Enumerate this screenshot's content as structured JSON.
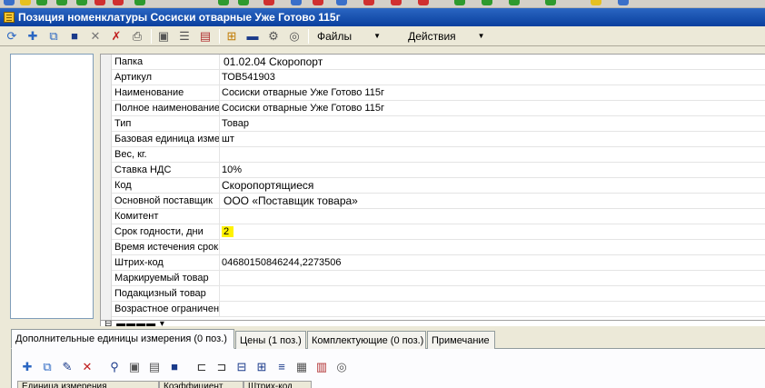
{
  "window": {
    "title": "Позиция номенклатуры Сосиски отварные Уже Готово 115г"
  },
  "toolbar": {
    "icons": [
      "refresh-icon",
      "add-icon",
      "copy-icon",
      "save-icon",
      "close-icon",
      "delete-mark-icon",
      "print-icon",
      "form-icon",
      "list-icon",
      "history-icon",
      "structure-icon",
      "monitor-icon",
      "settings-icon",
      "options-icon"
    ],
    "files_label": "Файлы",
    "actions_label": "Действия"
  },
  "properties": [
    {
      "label": "Папка",
      "value": "01.02.04 Скоропорт"
    },
    {
      "label": "Артикул",
      "value": "ТОВ541903"
    },
    {
      "label": "Наименование",
      "value": "Сосиски отварные Уже Готово 115г"
    },
    {
      "label": "Полное наименование",
      "value": "Сосиски отварные Уже Готово 115г"
    },
    {
      "label": "Тип",
      "value": "Товар"
    },
    {
      "label": "Базовая единица измерения",
      "value": "шт"
    },
    {
      "label": "Вес, кг.",
      "value": ""
    },
    {
      "label": "Ставка НДС",
      "value": "10%"
    },
    {
      "label": "Код",
      "value": "Скоропортящиеся"
    },
    {
      "label": "Основной поставщик",
      "value": "ООО «Поставщик товара»"
    },
    {
      "label": "Комитент",
      "value": ""
    },
    {
      "label": "Срок годности, дни",
      "value": "2"
    },
    {
      "label": "Время истечения срока",
      "value": ""
    },
    {
      "label": "Штрих-код",
      "value": "04680150846244,2273506"
    },
    {
      "label": "Маркируемый товар",
      "value": ""
    },
    {
      "label": "Подакцизный товар",
      "value": ""
    },
    {
      "label": "Возрастное ограничение",
      "value": ""
    }
  ],
  "tabs": [
    {
      "label": "Дополнительные единицы измерения (0 поз.)"
    },
    {
      "label": "Цены (1 поз.)"
    },
    {
      "label": "Комплектующие (0 поз.)"
    },
    {
      "label": "Примечание"
    }
  ],
  "grid": {
    "columns": [
      "Единица измерения",
      "Коэффициент",
      "Штрих-код"
    ]
  },
  "colors": {
    "title_bar": "#0a3f9e",
    "highlight": "#fff200",
    "toolbar_bg": "#ece9d8"
  }
}
